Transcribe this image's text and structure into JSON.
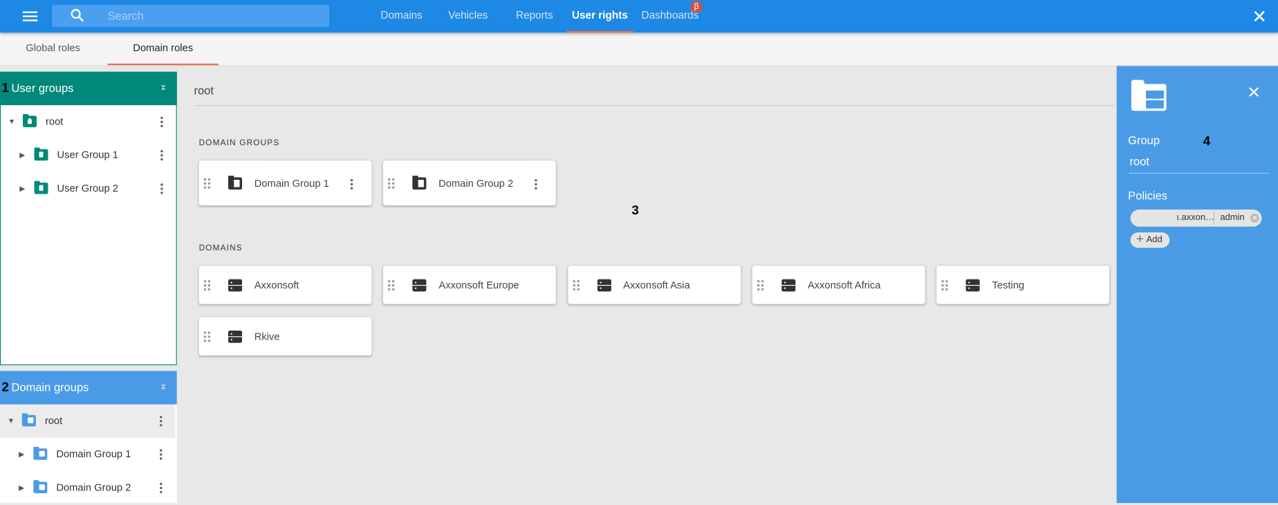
{
  "topbar": {
    "menu_icon": "hamburger-icon",
    "search_placeholder": "Search",
    "nav": [
      "Domains",
      "Vehicles",
      "Reports",
      "User rights",
      "Dashboards"
    ],
    "active_nav": "User rights",
    "beta_badge": "β",
    "accent": "#1e88e5"
  },
  "tabs": {
    "items": [
      "Global roles",
      "Domain roles"
    ],
    "active": "Domain roles"
  },
  "user_groups": {
    "marker": "1",
    "title": "User groups",
    "color": "#00897b",
    "items": [
      {
        "label": "root",
        "expanded": true
      },
      {
        "label": "User Group 1",
        "expanded": false
      },
      {
        "label": "User Group 2",
        "expanded": false
      }
    ]
  },
  "domain_groups_panel": {
    "marker": "2",
    "title": "Domain groups",
    "color": "#4a9be6",
    "items": [
      {
        "label": "root",
        "expanded": true,
        "selected": true
      },
      {
        "label": "Domain Group 1",
        "expanded": false
      },
      {
        "label": "Domain Group 2",
        "expanded": false
      }
    ]
  },
  "main": {
    "marker": "3",
    "title": "root",
    "domain_groups_heading": "DOMAIN GROUPS",
    "domain_groups": [
      "Domain Group 1",
      "Domain Group 2"
    ],
    "domains_heading": "DOMAINS",
    "domains": [
      "Axxonsoft",
      "Axxonsoft Europe",
      "Axxonsoft Asia",
      "Axxonsoft Africa",
      "Testing",
      "Rkive"
    ]
  },
  "details": {
    "marker": "4",
    "group_label": "Group",
    "group_value": "root",
    "policies_label": "Policies",
    "policy": {
      "scope": "ı.axxon…",
      "role": "admin"
    },
    "add_label": "Add"
  }
}
